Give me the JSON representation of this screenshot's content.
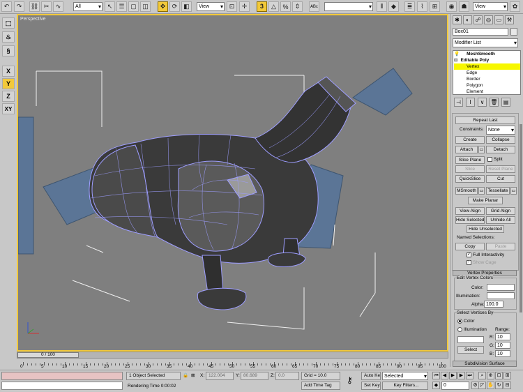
{
  "toolbar": {
    "selection_filter": "All",
    "ref_coord": "View",
    "named_selection": "",
    "view_dropdown": "View"
  },
  "left_toolbar": {
    "axis_x": "X",
    "axis_y": "Y",
    "axis_z": "Z",
    "axis_xy": "XY"
  },
  "viewport": {
    "label": "Perspective"
  },
  "command_panel": {
    "object_name": "Box01",
    "modifier_list": "Modifier List",
    "stack": [
      {
        "label": "MeshSmooth",
        "level": "modifier"
      },
      {
        "label": "Editable Poly",
        "level": "base"
      },
      {
        "label": "Vertex",
        "level": "sub",
        "selected": true
      },
      {
        "label": "Edge",
        "level": "sub"
      },
      {
        "label": "Border",
        "level": "sub"
      },
      {
        "label": "Polygon",
        "level": "sub"
      },
      {
        "label": "Element",
        "level": "sub"
      }
    ],
    "edit_geometry": {
      "repeat_last": "Repeat Last",
      "constraints_label": "Constraints:",
      "constraints_value": "None",
      "create": "Create",
      "collapse": "Collapse",
      "attach": "Attach",
      "detach": "Detach",
      "slice_plane": "Slice Plane",
      "split": "Split",
      "slice": "Slice",
      "reset_plane": "Reset Plane",
      "quickslice": "QuickSlice",
      "cut": "Cut",
      "msmooth": "MSmooth",
      "tessellate": "Tessellate",
      "make_planar": "Make Planar",
      "view_align": "View Align",
      "grid_align": "Grid Align",
      "hide_selected": "Hide Selected",
      "unhide_all": "Unhide All",
      "hide_unselected": "Hide Unselected",
      "named_selections": "Named Selections:",
      "copy": "Copy",
      "paste": "Paste",
      "full_interactivity": "Full Interactivity",
      "show_cage": "Show Cage"
    },
    "vertex_properties": {
      "title": "Vertex Properties",
      "edit_colors": "Edit Vertex Colors",
      "color_label": "Color:",
      "illumination_label": "Illumination:",
      "alpha_label": "Alpha:",
      "alpha_value": "100.0",
      "select_by": "Select Vertices By",
      "color_radio": "Color",
      "illum_radio": "Illumination",
      "range": "Range:",
      "r_label": "R:",
      "g_label": "G:",
      "b_label": "B:",
      "r_value": "10",
      "g_value": "10",
      "b_value": "10",
      "select_btn": "Select"
    },
    "subdivision_surface": "Subdivision Surface"
  },
  "timeline": {
    "slider_label": "0 / 100",
    "ticks": [
      "0",
      "5",
      "10",
      "15",
      "20",
      "25",
      "30",
      "35",
      "40",
      "45",
      "50",
      "55",
      "60",
      "65",
      "70",
      "75",
      "80",
      "85",
      "90",
      "95",
      "100"
    ]
  },
  "status": {
    "objects_selected": "1 Object Selected",
    "rendering_time": "Rendering Time  0:00:02",
    "x_label": "X:",
    "x_value": "122.004",
    "y_label": "Y:",
    "y_value": "80.689",
    "z_label": "Z:",
    "z_value": "0.0",
    "grid": "Grid = 10.0",
    "add_time_tag": "Add Time Tag",
    "auto_key": "Auto Key",
    "set_key": "Set Key",
    "key_mode": "Selected",
    "key_filters": "Key Filters...",
    "frame": "0"
  },
  "colors": {
    "accent": "#f2c93a",
    "viewport_bg": "#7f7f7f",
    "mesh": "#3c3c3c",
    "wire": "#a8a8ff",
    "plane": "#5b7596",
    "stack_selected": "#f7f700"
  }
}
